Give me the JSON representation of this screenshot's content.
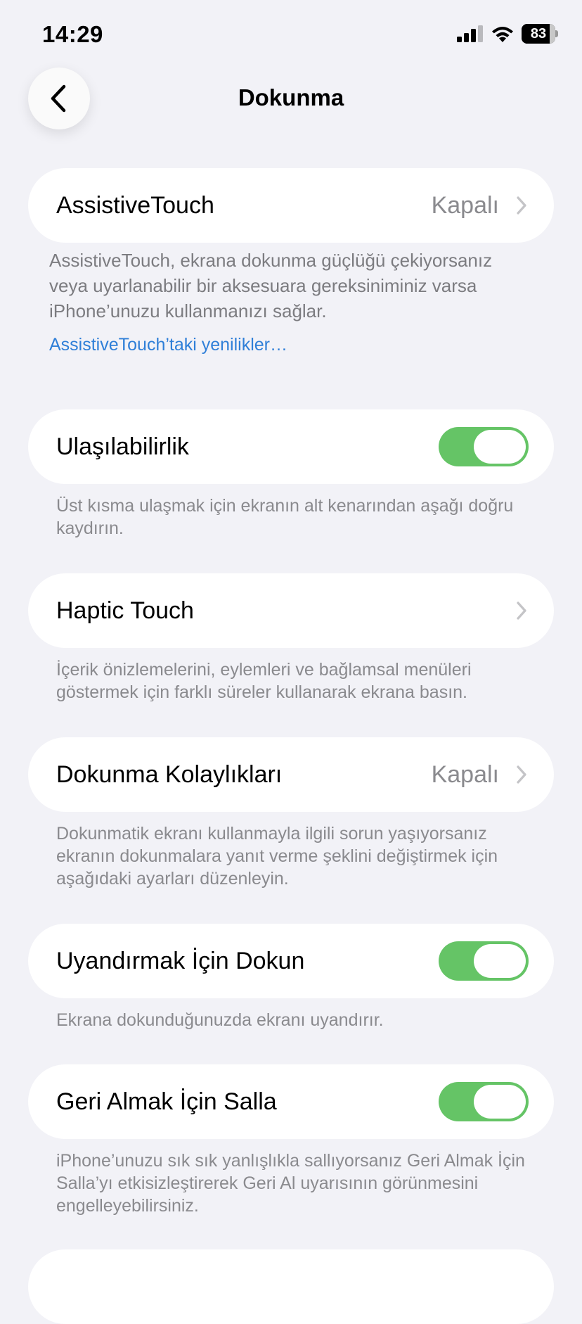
{
  "status_bar": {
    "time": "14:29",
    "battery_percent": "83"
  },
  "nav": {
    "title": "Dokunma",
    "back_icon": "chevron-left-icon"
  },
  "rows": {
    "assistive_touch": {
      "label": "AssistiveTouch",
      "value": "Kapalı",
      "footer": "AssistiveTouch, ekrana dokunma güçlüğü çekiyorsanız veya uyarlanabilir bir aksesuara gereksiniminiz varsa iPhone’unuzu kullanmanızı sağlar.",
      "link": "AssistiveTouch’taki yenilikler…"
    },
    "reachability": {
      "label": "Ulaşılabilirlik",
      "toggle_on": true,
      "footer": "Üst kısma ulaşmak için ekranın alt kenarından aşağı doğru kaydırın."
    },
    "haptic_touch": {
      "label": "Haptic Touch",
      "footer": "İçerik önizlemelerini, eylemleri ve bağlamsal menüleri göstermek için farklı süreler kullanarak ekrana basın."
    },
    "touch_accommodations": {
      "label": "Dokunma Kolaylıkları",
      "value": "Kapalı",
      "footer": "Dokunmatik ekranı kullanmayla ilgili sorun yaşıyorsanız ekranın dokunmalara yanıt verme şeklini değiştirmek için aşağıdaki ayarları düzenleyin."
    },
    "tap_to_wake": {
      "label": "Uyandırmak İçin Dokun",
      "toggle_on": true,
      "footer": "Ekrana dokunduğunuzda ekranı uyandırır."
    },
    "shake_to_undo": {
      "label": "Geri Almak İçin Salla",
      "toggle_on": true,
      "footer": "iPhone’unuzu sık sık yanlışlıkla sallıyorsanız Geri Almak İçin Salla’yı etkisizleştirerek Geri Al uyarısının görünmesini engelleyebilirsiniz."
    }
  },
  "colors": {
    "background": "#f2f2f7",
    "toggle_on": "#65c466",
    "link": "#2f7fd8",
    "secondary_text": "#8a8a8e"
  }
}
